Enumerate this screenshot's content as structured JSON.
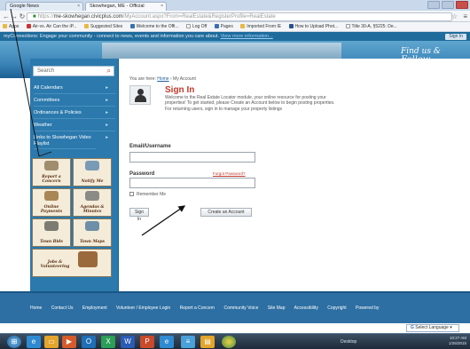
{
  "browser": {
    "tabs": [
      {
        "label": "Google News",
        "active": false
      },
      {
        "label": "Skowhegan, ME - Official",
        "active": true
      }
    ],
    "url_prefix": "https://",
    "url_host": "me-skowhegan.civicplus.com",
    "url_path": "/MyAccount.aspx?From=RealEstate&RegisterProfile=RealEstate",
    "bookmarks": [
      "Apps",
      "Air-vs. Air Can the iP...",
      "Suggested Sites",
      "Welcome to the Offi...",
      "Log Off",
      "Pages",
      "Imported From IE",
      "How to Upload Phot...",
      "Title 30-A, §5225: De..."
    ]
  },
  "mc_bar": {
    "text": "myConnections: Engage your community - connect to news, events and information you care about.",
    "link": "View more information...",
    "signin_label": "Sign In"
  },
  "banner": {
    "follow_line1": "Find us &",
    "follow_line2": "Follow"
  },
  "sidebar": {
    "search_placeholder": "Search",
    "items": [
      "All Calendars",
      "Committees",
      "Ordinances & Policies",
      "Weather",
      "Links to Skowhegan Video Playlist"
    ],
    "tiles": [
      "Report a Concern",
      "Notify Me",
      "Online Payments",
      "Agendas & Minutes",
      "Town Bids",
      "Town Maps",
      "Jobs & Volunteering"
    ]
  },
  "main": {
    "breadcrumb_prefix": "You are here:",
    "breadcrumb_home": "Home",
    "breadcrumb_sep": " › ",
    "breadcrumb_current": "My Account",
    "title": "Sign In",
    "intro": "Welcome to the Real Estate Locator module, your online resource for posting your properties! To get started, please Create an Account below to begin posting properties. For returning users, sign in to manage your property listings",
    "email_label": "Email/Username",
    "password_label": "Password",
    "forgot_label": "Forgot Password?",
    "remember_label": "Remember Me",
    "signin_button": "Sign In",
    "create_button": "Create an Account"
  },
  "footer": {
    "links": [
      "Home",
      "Contact Us",
      "Employment",
      "Volunteer / Employee Login",
      "Report a Concern",
      "Community Voice",
      "Site Map",
      "Accessibility",
      "Copyright",
      "Powered by"
    ],
    "select_language": "Select Language"
  },
  "taskbar": {
    "desktop_label": "Desktop",
    "time": "10:27 AM",
    "date": "1/26/2015"
  },
  "colors": {
    "brand_blue": "#2b79ad",
    "accent_red": "#c0392b",
    "banner_blue": "#3b85b8"
  }
}
